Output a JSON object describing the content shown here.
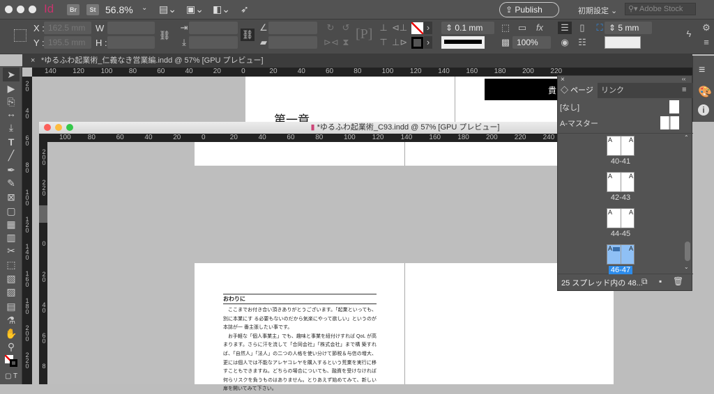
{
  "app": {
    "logo": "Id",
    "bridge": "Br",
    "stock": "St",
    "zoom": "56.8%",
    "publish": "Publish Online",
    "workspace": "初期設定",
    "search_placeholder": "Adobe Stock"
  },
  "control": {
    "x_label": "X :",
    "x_value": "162.5 mm",
    "y_label": "Y :",
    "y_value": "195.5 mm",
    "w_label": "W :",
    "h_label": "H :",
    "stroke_weight": "0.1 mm",
    "opacity": "100%",
    "gap": "5 mm"
  },
  "tab": {
    "title": "*ゆるふわ起業術_仁義なき営業編.indd @ 57% [GPU プレビュー]"
  },
  "window2": {
    "title": "*ゆるふわ起業術_C93.indd @ 57% [GPU プレビュー]"
  },
  "ruler_main": [
    "140",
    "120",
    "100",
    "80",
    "60",
    "40",
    "20",
    "0",
    "20",
    "40",
    "60",
    "80",
    "100",
    "120",
    "140",
    "160",
    "180",
    "200",
    "220"
  ],
  "ruler_main_v": [
    "20",
    "40",
    "60",
    "80",
    "100",
    "120",
    "140",
    "160",
    "180",
    "200",
    "220"
  ],
  "ruler_win2": [
    "100",
    "80",
    "60",
    "40",
    "20",
    "0",
    "20",
    "40",
    "60",
    "80",
    "100",
    "120",
    "140",
    "160",
    "180",
    "200",
    "220",
    "240"
  ],
  "ruler_win2_v": [
    "200",
    "220",
    "20",
    "0",
    "20",
    "40",
    "60",
    "8"
  ],
  "back_doc": {
    "chapter": "第一章",
    "header_char": "貴"
  },
  "document": {
    "heading": "おわりに",
    "paragraphs": [
      "ここまでお付き合い頂きありがとうございます。「起業といっても、別に本業にす る必要もないのだから気楽にやって欲しい」というのが本誌が一 番主張したい事です。",
      "お手軽な「個人事業主」でも、趣味と事業を紐付けすれば QoL が高まります。さらに汗を流して「合同会社」「株式会社」まで構 築すれば、「自然人」「法人」の二つの人格を使い分けて節税＆与信の増大、更には個人では不能なアレヤコレヤを購入するという荒業を実行に移すこともできますね。どちらの場合についても、融資を受けなければ何らリスクを負うものはありません。とりあえず始めてみて、新しい扉を開いてみて下さい。"
    ]
  },
  "pages_panel": {
    "tab_pages": "ページ",
    "tab_links": "リンク",
    "none": "[なし]",
    "master": "A-マスター",
    "master_prefix": "A",
    "spreads": [
      "40-41",
      "42-43",
      "44-45",
      "46-47"
    ],
    "selected": "46-47",
    "status": "25 スプレッド内の 48..."
  },
  "colors": {
    "accent": "#2d8ceb",
    "selected_thumb": "#8fc0f5"
  }
}
